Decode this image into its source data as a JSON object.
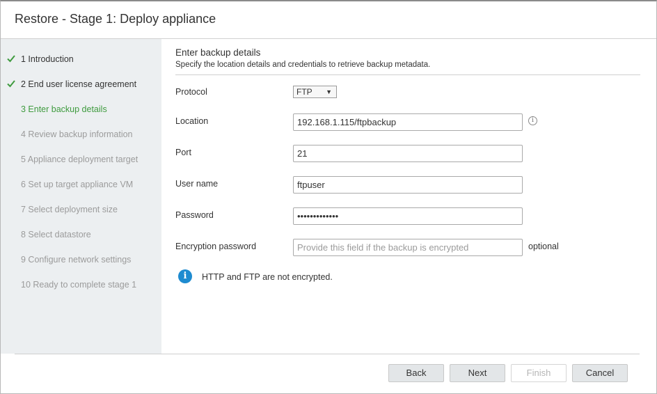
{
  "dialog": {
    "title": "Restore - Stage 1: Deploy appliance"
  },
  "sidebar": {
    "steps": [
      {
        "label": "1 Introduction",
        "state": "done"
      },
      {
        "label": "2 End user license agreement",
        "state": "done"
      },
      {
        "label": "3 Enter backup details",
        "state": "current"
      },
      {
        "label": "4 Review backup information",
        "state": "pending"
      },
      {
        "label": "5 Appliance deployment target",
        "state": "pending"
      },
      {
        "label": "6 Set up target appliance VM",
        "state": "pending"
      },
      {
        "label": "7 Select deployment size",
        "state": "pending"
      },
      {
        "label": "8 Select datastore",
        "state": "pending"
      },
      {
        "label": "9 Configure network settings",
        "state": "pending"
      },
      {
        "label": "10 Ready to complete stage 1",
        "state": "pending"
      }
    ]
  },
  "content": {
    "title": "Enter backup details",
    "description": "Specify the location details and credentials to retrieve backup metadata.",
    "fields": {
      "protocol": {
        "label": "Protocol",
        "value": "FTP"
      },
      "location": {
        "label": "Location",
        "value": "192.168.1.115/ftpbackup"
      },
      "port": {
        "label": "Port",
        "value": "21"
      },
      "username": {
        "label": "User name",
        "value": "ftpuser"
      },
      "password": {
        "label": "Password",
        "value": "•••••••••••••"
      },
      "encryption": {
        "label": "Encryption password",
        "value": "",
        "placeholder": "Provide this field if the backup is encrypted",
        "note": "optional"
      }
    },
    "notice": "HTTP and FTP are not encrypted."
  },
  "footer": {
    "back": "Back",
    "next": "Next",
    "finish": "Finish",
    "cancel": "Cancel"
  },
  "colors": {
    "current_step": "#3f9b3f",
    "check": "#3f9b3f",
    "info_icon": "#1e8bd0",
    "sidebar_bg": "#eceff1"
  }
}
